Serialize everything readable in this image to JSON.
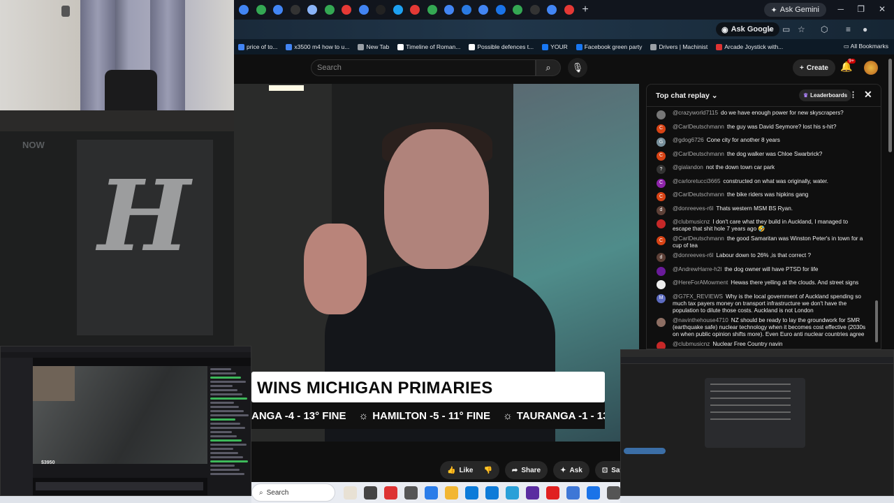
{
  "browser": {
    "ask_gemini": "Ask Gemini",
    "ask_google": "Ask Google",
    "bookmarks": [
      {
        "label": "price of to...",
        "color": "#4285f4"
      },
      {
        "label": "x3500 m4 how to u...",
        "color": "#4285f4"
      },
      {
        "label": "New Tab",
        "color": "#9aa0a6"
      },
      {
        "label": "Timeline of Roman...",
        "color": "#ffffff"
      },
      {
        "label": "Possible defences t...",
        "color": "#ffffff"
      },
      {
        "label": "YOUR",
        "color": "#1877f2"
      },
      {
        "label": "Facebook green party",
        "color": "#1877f2"
      },
      {
        "label": "Drivers | Machinist",
        "color": "#9aa0a6"
      },
      {
        "label": "Arcade Joystick with...",
        "color": "#d33"
      }
    ],
    "all_bookmarks": "All Bookmarks"
  },
  "youtube": {
    "search_placeholder": "Search",
    "create_label": "Create",
    "notif_count": "9+",
    "lower_third": "WINS MICHIGAN PRIMARIES",
    "ticker": [
      "ANGA -4 - 13° FINE",
      "HAMILTON -5 - 11° FINE",
      "TAURANGA -1 - 13"
    ],
    "actions": {
      "like": "Like",
      "share": "Share",
      "ask": "Ask",
      "save": "Save"
    }
  },
  "herald": {
    "now": "NOW",
    "logo": "H"
  },
  "chat": {
    "title": "Top chat replay",
    "leaderboards": "Leaderboards",
    "messages": [
      {
        "user": "@crazyworld7115",
        "text": "do we have enough power for new skyscrapers?",
        "avatar_color": "#777",
        "initial": ""
      },
      {
        "user": "@CarlDeutschmann",
        "text": "the guy was David Seymore? lost his s-hit?",
        "avatar_color": "#d84315",
        "initial": "C"
      },
      {
        "user": "@gdog6726",
        "text": "Cone city for another 8 years",
        "avatar_color": "#78909c",
        "initial": "G"
      },
      {
        "user": "@CarlDeutschmann",
        "text": "the dog walker was Chloe Swarbrick?",
        "avatar_color": "#d84315",
        "initial": "C"
      },
      {
        "user": "@gialandon",
        "text": "not the down town car park",
        "avatar_color": "#333",
        "initial": "?"
      },
      {
        "user": "@carloretucci3665",
        "text": "constructed on what was originally, water.",
        "avatar_color": "#8e24aa",
        "initial": "C"
      },
      {
        "user": "@CarlDeutschmann",
        "text": "the bike riders was hipkins gang",
        "avatar_color": "#d84315",
        "initial": "C"
      },
      {
        "user": "@donreeves-r6l",
        "text": "Thats western MSM BS Ryan.",
        "avatar_color": "#5d4037",
        "initial": "d"
      },
      {
        "user": "@clubmusicnz",
        "text": "I don't care what they build in Auckland, I managed to escape that shit hole 7 years ago 🤣",
        "avatar_color": "#c62828",
        "initial": ""
      },
      {
        "user": "@CarlDeutschmann",
        "text": "the good Samaritan was Winston Peter's in town for a cup of tea",
        "avatar_color": "#d84315",
        "initial": "C"
      },
      {
        "user": "@donreeves-r6l",
        "text": "Labour down to 26% ,is that correct ?",
        "avatar_color": "#5d4037",
        "initial": "d"
      },
      {
        "user": "@AndrewHarre-h2l",
        "text": "the dog owner will have PTSD for life",
        "avatar_color": "#6a1b9a",
        "initial": ""
      },
      {
        "user": "@HereForAMowment",
        "text": "Hewas there yelling at the clouds. And street signs",
        "avatar_color": "#eee",
        "initial": ""
      },
      {
        "user": "@G7FX_REVIEWS",
        "text": "Why is the local government of Auckland spending so much tax payers money on transport infrastructure we don't have the population to dilute those costs. Auckland is not London",
        "avatar_color": "#5c6bc0",
        "initial": "M"
      },
      {
        "user": "@navinthehouse4710",
        "text": "NZ should be ready to lay the groundwork for SMR (earthquake safe) nuclear technology when it becomes cost effective (2030s on when public opinion shifts more). Even Euro anti nuclear countries agree",
        "avatar_color": "#8d6e63",
        "initial": ""
      },
      {
        "user": "@clubmusicnz",
        "text": "Nuclear Free Country navin",
        "avatar_color": "#c62828",
        "initial": ""
      }
    ]
  },
  "twitch": {
    "money": "$3950"
  },
  "taskbar": {
    "search": "Search",
    "icons": [
      "#e8e1d4",
      "#444",
      "#d33",
      "#555",
      "#2b7de9",
      "#f2b632",
      "#0c7bd9",
      "#0e7bd8",
      "#2aa0d8",
      "#5a2ca0",
      "#e02020",
      "#3e77d6",
      "#1a73e8",
      "#555"
    ]
  },
  "colors": {
    "tab_favicons": [
      "#4285f4",
      "#34a853",
      "#4285f4",
      "#333",
      "#8ab4f8",
      "#34a853",
      "#e53935",
      "#4285f4",
      "#222",
      "#1da1f2",
      "#e53935",
      "#34a853",
      "#4285f4",
      "#2a7ae2",
      "#4285f4",
      "#1a73e8",
      "#34a853",
      "#333",
      "#4285f4",
      "#e53935"
    ]
  }
}
